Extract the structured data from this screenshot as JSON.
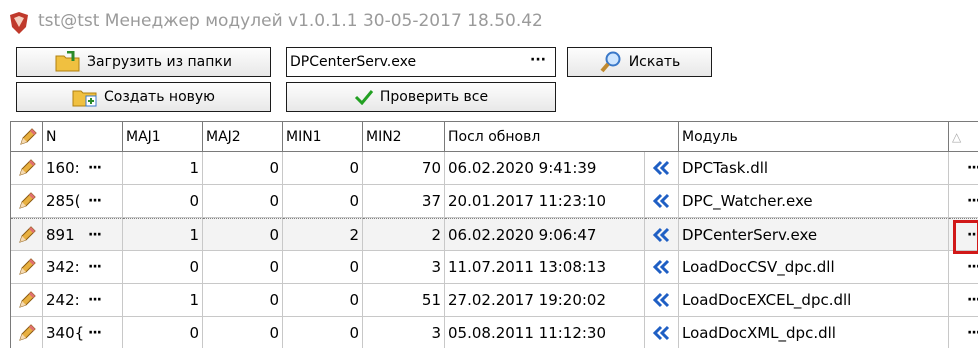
{
  "window": {
    "title": "tst@tst Менеджер модулей v1.0.1.1 30-05-2017 18.50.42",
    "icon": "app-shield-icon"
  },
  "toolbar": {
    "load_from_folder_label": "Загрузить из папки",
    "create_new_label": "Создать новую",
    "file_value": "DPCenterServ.exe",
    "browse_label": "···",
    "search_label": "Искать",
    "check_all_label": "Проверить все"
  },
  "grid": {
    "columns": [
      "N",
      "MAJ1",
      "MAJ2",
      "MIN1",
      "MIN2",
      "Посл обновл",
      "Модуль"
    ],
    "sort_indicator": "△",
    "row_button_label": "···",
    "selected_row_index": 2,
    "rows": [
      {
        "n": "160:",
        "maj1": "1",
        "maj2": "0",
        "min1": "0",
        "min2": "70",
        "updated": "06.02.2020 9:41:39",
        "module": "DPCTask.dll"
      },
      {
        "n": "285(",
        "maj1": "0",
        "maj2": "0",
        "min1": "0",
        "min2": "37",
        "updated": "20.01.2017 11:23:10",
        "module": "DPC_Watcher.exe"
      },
      {
        "n": "891",
        "maj1": "1",
        "maj2": "0",
        "min1": "2",
        "min2": "2",
        "updated": "06.02.2020 9:06:47",
        "module": "DPCenterServ.exe"
      },
      {
        "n": "342:",
        "maj1": "0",
        "maj2": "0",
        "min1": "0",
        "min2": "3",
        "updated": "11.07.2011 13:08:13",
        "module": "LoadDocCSV_dpc.dll"
      },
      {
        "n": "242:",
        "maj1": "1",
        "maj2": "0",
        "min1": "0",
        "min2": "51",
        "updated": "27.02.2017 19:20:02",
        "module": "LoadDocEXCEL_dpc.dll"
      },
      {
        "n": "340{",
        "maj1": "0",
        "maj2": "0",
        "min1": "0",
        "min2": "3",
        "updated": "05.08.2011 11:12:30",
        "module": "LoadDocXML_dpc.dll"
      }
    ]
  },
  "colors": {
    "highlight": "#d11818",
    "arrow": "#1f5fc4",
    "check": "#22a022"
  }
}
